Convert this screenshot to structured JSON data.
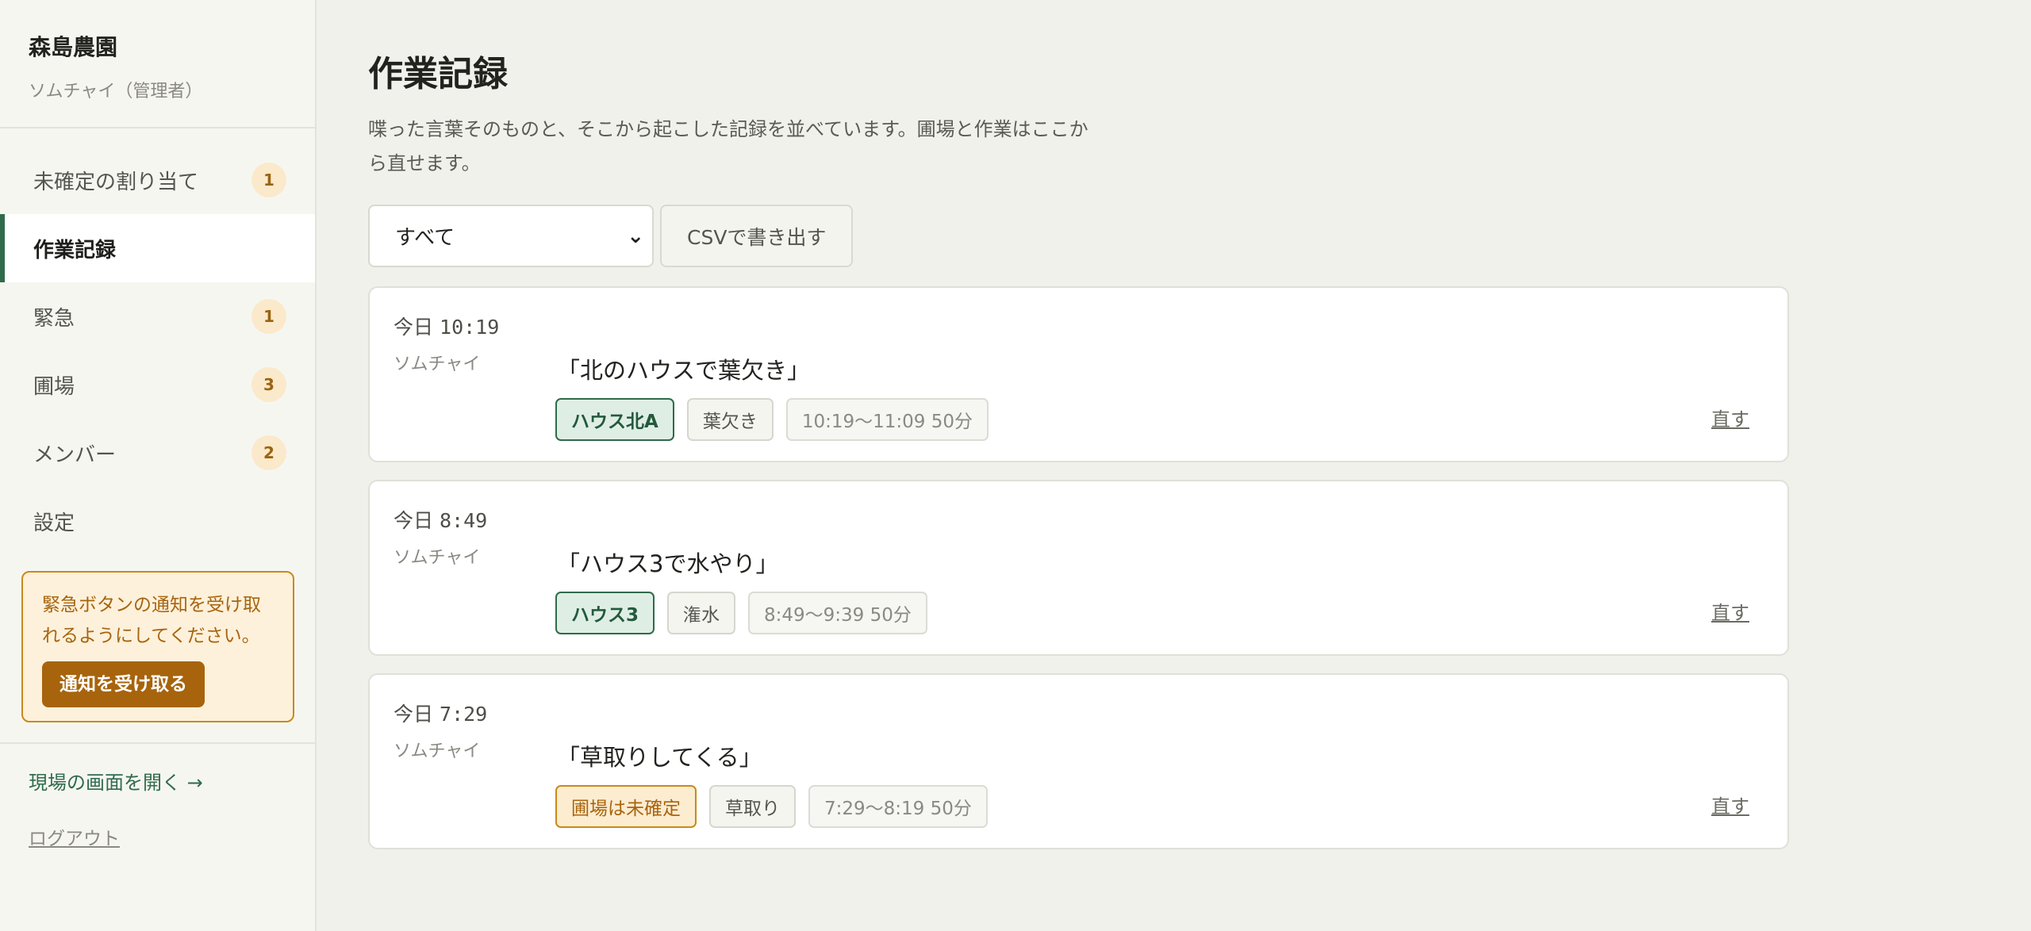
{
  "sidebar": {
    "brand_name": "森島農園",
    "user": "ソムチャイ（管理者）",
    "items": [
      {
        "label": "未確定の割り当て",
        "badge": "1"
      },
      {
        "label": "作業記録",
        "badge": null
      },
      {
        "label": "緊急",
        "badge": "1"
      },
      {
        "label": "圃場",
        "badge": "3"
      },
      {
        "label": "メンバー",
        "badge": "2"
      },
      {
        "label": "設定",
        "badge": null
      }
    ],
    "notice_text": "緊急ボタンの通知を受け取れるようにしてください。",
    "notice_button": "通知を受け取る",
    "field_link": "現場の画面を開く →",
    "logout": "ログアウト"
  },
  "main": {
    "title": "作業記録",
    "description": "喋った言葉そのものと、そこから起こした記録を並べています。圃場と作業はここから直せます。",
    "filter_value": "すべて",
    "csv_button": "CSVで書き出す",
    "records": [
      {
        "day": "今日",
        "time": "10:19",
        "user": "ソムチャイ",
        "quote": "「北のハウスで葉欠き」",
        "field": "ハウス北A",
        "field_state": "assigned",
        "task": "葉欠き",
        "span": "10:19〜11:09 50分",
        "fix": "直す"
      },
      {
        "day": "今日",
        "time": "8:49",
        "user": "ソムチャイ",
        "quote": "「ハウス3で水やり」",
        "field": "ハウス3",
        "field_state": "assigned",
        "task": "潅水",
        "span": "8:49〜9:39 50分",
        "fix": "直す"
      },
      {
        "day": "今日",
        "time": "7:29",
        "user": "ソムチャイ",
        "quote": "「草取りしてくる」",
        "field": "圃場は未確定",
        "field_state": "pending",
        "task": "草取り",
        "span": "7:29〜8:19 50分",
        "fix": "直す"
      }
    ]
  },
  "colors": {
    "accent": "#2f6b4a",
    "warning": "#c98a1c",
    "warning_bg": "#fdf1db",
    "background": "#f1f1ec"
  }
}
